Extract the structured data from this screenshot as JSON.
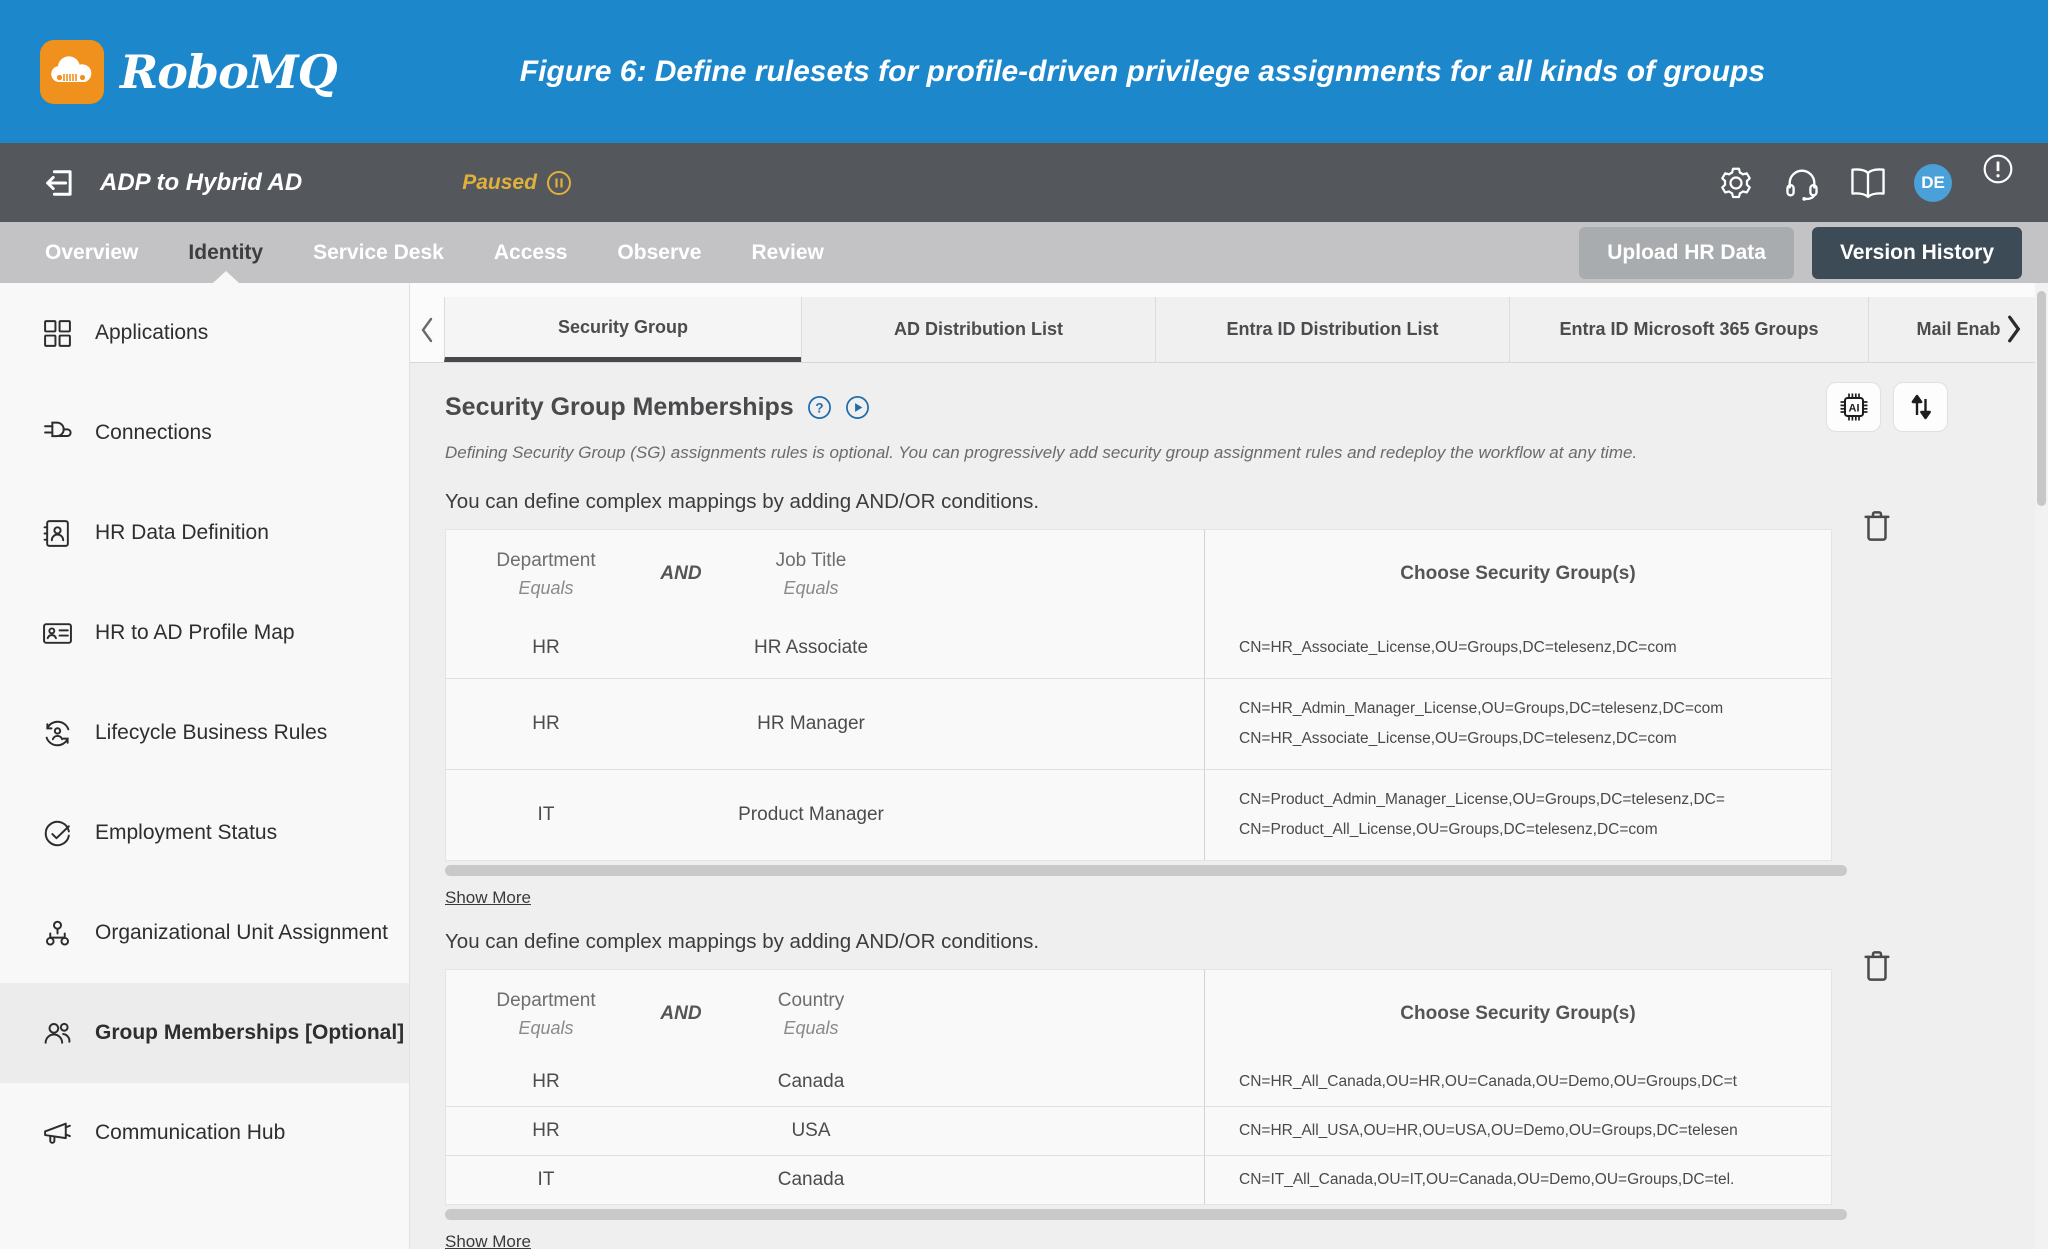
{
  "colors": {
    "header_blue": "#1d87cb",
    "logo_orange": "#f1911d",
    "workflow_bar_gray": "#54585d",
    "paused_yellow": "#e0b03c",
    "nav_gray": "#c3c3c5",
    "button_gray": "#a9acae",
    "button_dark": "#3c4b55",
    "avatar_blue": "#4aa0d9",
    "accent_blue": "#1f6cab",
    "sidebar_bg": "#f8f8f8",
    "active_item_bg": "#ececec"
  },
  "header": {
    "brand": "RoboMQ",
    "title": "Figure 6: Define rulesets for profile-driven privilege assignments for all kinds of groups"
  },
  "workflow": {
    "name": "ADP to Hybrid AD",
    "status": "Paused",
    "avatar_initials": "DE",
    "icons": [
      "back",
      "pause-circle",
      "settings-gear",
      "support-headset",
      "documentation-book",
      "avatar",
      "alert-circle"
    ]
  },
  "nav": {
    "items": [
      "Overview",
      "Identity",
      "Service Desk",
      "Access",
      "Observe",
      "Review"
    ],
    "active_item": "Identity",
    "upload_label": "Upload HR Data",
    "version_label": "Version History"
  },
  "sidebar": {
    "items": [
      {
        "icon": "apps-grid",
        "label": "Applications"
      },
      {
        "icon": "plug",
        "label": "Connections"
      },
      {
        "icon": "address-book",
        "label": "HR Data Definition"
      },
      {
        "icon": "id-card",
        "label": "HR to AD Profile Map"
      },
      {
        "icon": "person-cycle",
        "label": "Lifecycle Business Rules"
      },
      {
        "icon": "check-circle",
        "label": "Employment Status"
      },
      {
        "icon": "org-chart",
        "label": "Organizational Unit Assignment"
      },
      {
        "icon": "users",
        "label": "Group Memberships [Optional]"
      },
      {
        "icon": "megaphone",
        "label": "Communication Hub"
      }
    ],
    "active_item": "Group Memberships [Optional]"
  },
  "content": {
    "tabs": [
      "Security Group",
      "AD Distribution List",
      "Entra ID Distribution List",
      "Entra ID Microsoft 365 Groups",
      "Mail Enab"
    ],
    "active_tab": "Security Group",
    "section": {
      "title": "Security Group Memberships",
      "description": "Defining Security Group (SG) assignments rules is optional. You can progressively add security group assignment rules and redeploy the workflow at any time.",
      "hint": "You can define complex mappings by adding AND/OR conditions.",
      "show_more_label": "Show More",
      "tables": [
        {
          "header": {
            "col1": "Department",
            "col1_op": "Equals",
            "join": "AND",
            "col2": "Job Title",
            "col2_op": "Equals",
            "groups_label": "Choose Security Group(s)"
          },
          "rows": [
            {
              "c1": "HR",
              "c2": "HR Associate",
              "groups": [
                "CN=HR_Associate_License,OU=Groups,DC=telesenz,DC=com"
              ]
            },
            {
              "c1": "HR",
              "c2": "HR Manager",
              "groups": [
                "CN=HR_Admin_Manager_License,OU=Groups,DC=telesenz,DC=com",
                "CN=HR_Associate_License,OU=Groups,DC=telesenz,DC=com"
              ]
            },
            {
              "c1": "IT",
              "c2": "Product Manager",
              "groups": [
                "CN=Product_Admin_Manager_License,OU=Groups,DC=telesenz,DC=",
                "CN=Product_All_License,OU=Groups,DC=telesenz,DC=com"
              ]
            }
          ]
        },
        {
          "header": {
            "col1": "Department",
            "col1_op": "Equals",
            "join": "AND",
            "col2": "Country",
            "col2_op": "Equals",
            "groups_label": "Choose Security Group(s)"
          },
          "rows": [
            {
              "c1": "HR",
              "c2": "Canada",
              "groups": [
                "CN=HR_All_Canada,OU=HR,OU=Canada,OU=Demo,OU=Groups,DC=t"
              ]
            },
            {
              "c1": "HR",
              "c2": "USA",
              "groups": [
                "CN=HR_All_USA,OU=HR,OU=USA,OU=Demo,OU=Groups,DC=telesen"
              ]
            },
            {
              "c1": "IT",
              "c2": "Canada",
              "groups": [
                "CN=IT_All_Canada,OU=IT,OU=Canada,OU=Demo,OU=Groups,DC=tel."
              ]
            }
          ]
        }
      ]
    }
  }
}
